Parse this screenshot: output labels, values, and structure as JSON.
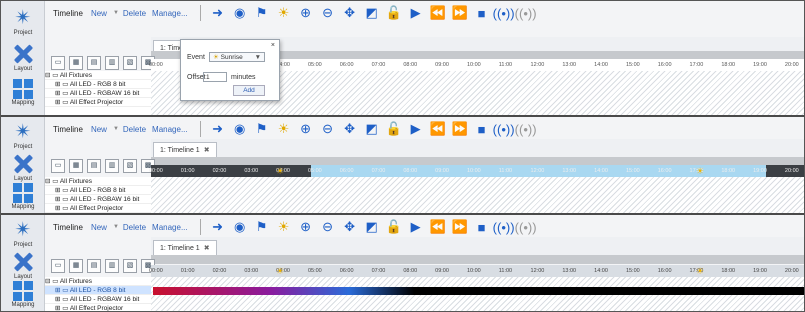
{
  "sidebar": {
    "project": "Project",
    "layout": "Layout",
    "mapping": "Mapping"
  },
  "toolbar": {
    "timeline": "Timeline",
    "new": "New",
    "delete": "Delete",
    "manage": "Manage..."
  },
  "tab": {
    "label": "1: Timeline 1",
    "close": "✖",
    "label_trunc": "1: Timeli"
  },
  "ruler": [
    "00:00",
    "01:00",
    "02:00",
    "03:00",
    "04:00",
    "05:00",
    "06:00",
    "07:00",
    "08:00",
    "09:00",
    "10:00",
    "11:00",
    "12:00",
    "13:00",
    "14:00",
    "15:00",
    "16:00",
    "17:00",
    "18:00",
    "19:00",
    "20:00"
  ],
  "tree": {
    "root": "All Fixtures",
    "i1": "All LED - RGB 8 bit",
    "i2": "All LED - RGBAW 16 bit",
    "i3": "All Effect Projector"
  },
  "popup": {
    "event_label": "Event",
    "event_value": "Sunrise",
    "offset_label": "Offset",
    "offset_value": "1",
    "minutes": "minutes",
    "add": "Add",
    "close": "×"
  }
}
